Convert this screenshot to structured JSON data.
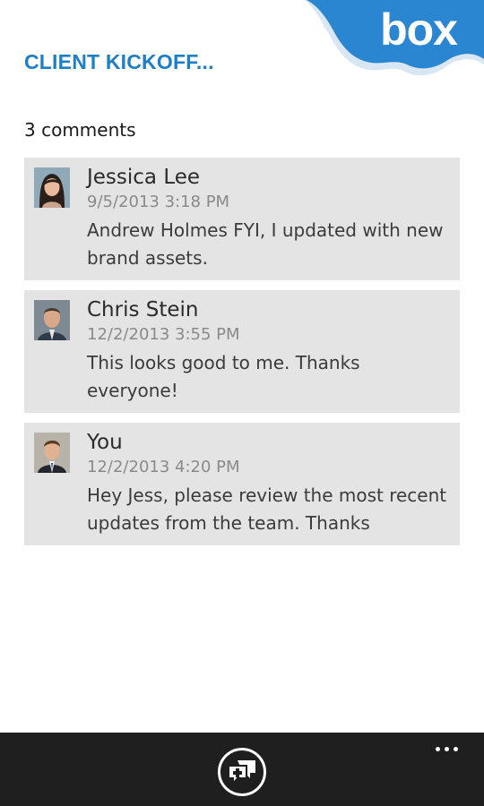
{
  "header": {
    "title": "CLIENT KICKOFF...",
    "brand_logo": "box",
    "brand_color": "#2a86d0"
  },
  "comments": {
    "count_label": "3 comments",
    "items": [
      {
        "author": "Jessica Lee",
        "timestamp": "9/5/2013 3:18 PM",
        "text": "Andrew Holmes FYI, I updated with new brand assets.",
        "avatar_icon": "avatar-jessica-lee-icon"
      },
      {
        "author": "Chris Stein",
        "timestamp": "12/2/2013 3:55 PM",
        "text": "This looks good to me. Thanks everyone!",
        "avatar_icon": "avatar-chris-stein-icon"
      },
      {
        "author": "You",
        "timestamp": "12/2/2013 4:20 PM",
        "text": "Hey Jess, please review the most recent updates from the team. Thanks",
        "avatar_icon": "avatar-you-icon"
      }
    ]
  },
  "app_bar": {
    "add_comment_icon": "add-comment-icon",
    "more_icon": "ellipsis-icon"
  },
  "colors": {
    "accent": "#1f7fc4",
    "card_background": "#e4e4e4",
    "app_bar_background": "#1f1f1f"
  }
}
